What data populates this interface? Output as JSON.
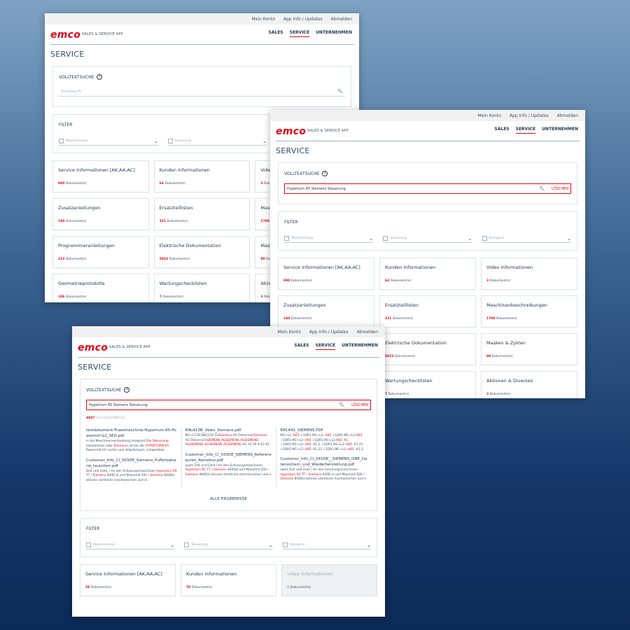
{
  "topbar": {
    "account": "Mein Konto",
    "appinfo": "App Info / Updates",
    "logout": "Abmelden"
  },
  "brand": {
    "logo": "emco",
    "app_name": "SALES & SERVICE APP"
  },
  "nav": {
    "sales": "SALES",
    "service": "SERVICE",
    "company": "UNTERNEHMEN"
  },
  "page_title": "SERVICE",
  "search": {
    "title": "VOLLTEXTSUCHE",
    "info": "i",
    "placeholder": "Suchbegriff",
    "query": "Hyperturn 65 Siemens Steuerung",
    "clear": "LÖSCHEN",
    "search_icon": "search-icon"
  },
  "filter": {
    "title": "FILTER",
    "machine": "Maschinentyp",
    "control": "Steuerung",
    "category": "Kategorie"
  },
  "doc_suffix": "Dokument(e)",
  "tiles": [
    {
      "title": "Service Informationen [AK,AA,AC]",
      "count": "900"
    },
    {
      "title": "Kunden Informationen",
      "count": "64"
    },
    {
      "title": "Video Informationen",
      "count": "3"
    },
    {
      "title": "Zusatzanleitungen",
      "count": "160"
    },
    {
      "title": "Ersatzteillisten",
      "count": "321"
    },
    {
      "title": "Maschinenbeschreibungen",
      "count": "1708"
    },
    {
      "title": "Programmieranleitungen",
      "count": "213"
    },
    {
      "title": "Elektrische Dokumentation",
      "count": "5023"
    },
    {
      "title": "Masken & Zyklen",
      "count": "89"
    },
    {
      "title": "Geometrieprotokolle",
      "count": "106"
    },
    {
      "title": "Wartungschecklisten",
      "count": "7"
    },
    {
      "title": "Aktionen & Diverses",
      "count": "3"
    }
  ],
  "w1_tiles_visible": [
    "Service Informationen [AK,AA,AC]",
    "Kunden Informationen",
    "Video",
    "Zusatzanleitungen",
    "Ersatzteillisten",
    "Masch",
    "Programmieranleitungen",
    "Elektrische Dokumentation",
    "Mask",
    "Geometrieprotokolle",
    "Wartungschecklisten",
    "Aktion"
  ],
  "w2_row3_partial": [
    "Elektrische Dokumentation",
    "Wartungschecklisten"
  ],
  "results_window": {
    "hits_count": "4047",
    "hits_label": "SUCHERGEBNISSE",
    "all_results": "ALLE ERGEBNISSE",
    "results": [
      [
        {
          "title": "testdokument-Fraesmaschine-Hyperturn-65-Powermill-G2_SEO.pdf",
          "snippet": [
            [
              "in die Maschinenverkleidung integriert.Die ",
              ""
            ],
            [
              "Steuerung",
              "hl"
            ],
            [
              " (Heidenhain oder ",
              ""
            ],
            [
              "Siemens",
              "hl"
            ],
            [
              ") ist bei der ",
              ""
            ],
            [
              "HYPERTURN 65",
              "hl"
            ],
            [
              " Powermill G2 rechts vom Arbeitsraum, schwenkbar",
              ""
            ]
          ]
        },
        {
          "title": "Customer_Info_CI_003DE_Siemens_Pufferbatterie_tauschen.pdf",
          "snippet": [
            [
              "Zeit und Geld. / An den Schulungsmaschinen ",
              ""
            ],
            [
              "Hyperturn 65",
              "hl"
            ],
            [
              " TT / ",
              ""
            ],
            [
              "Siemens",
              "hl"
            ],
            [
              " 840D sl und Maxxmill 500 / ",
              ""
            ],
            [
              "Siemens",
              "hl"
            ],
            [
              " 840Dsl können sämtliche mechanischen und el",
              ""
            ]
          ]
        }
      ],
      [
        {
          "title": "R9LA13B_Valeo_Siemens.pdf",
          "snippet": [
            [
              "M2+L178.SW2155 51",
              ""
            ],
            [
              "Siemens",
              "hl"
            ],
            [
              " AG Österreich",
              ""
            ],
            [
              "Siemens",
              "hl"
            ],
            [
              " AG Österreich",
              ""
            ],
            [
              "SIEMENS AGSIEMENS AGSIEMENS AGSIEMENS AGSIEMENS AGSIEMENS",
              "hl"
            ],
            [
              " AG 10 76 8 93 42",
              ""
            ]
          ]
        },
        {
          "title": "Customer_Info_CI_030DE_SIEMENS_Referenzpunkt_Korrektur.pdf",
          "snippet": [
            [
              "spart Zeit und Geld / An den Schulungsmaschinen ",
              ""
            ],
            [
              "Hyperturn 65",
              "hl"
            ],
            [
              " TT / ",
              ""
            ],
            [
              "Siemens",
              "hl"
            ],
            [
              " 840Dsl und Maxxmill 500 / ",
              ""
            ],
            [
              "Siemens",
              "hl"
            ],
            [
              " 840Dsl können sämtliche mechanischen und e",
              ""
            ]
          ]
        }
      ],
      [
        {
          "title": "R9CA91_SIEMENS.PDF",
          "snippet": [
            [
              "M1+L2-",
              ""
            ],
            [
              "-A65",
              "hl"
            ],
            [
              " +1DR1.M1+L2-",
              ""
            ],
            [
              "-A65",
              "hl"
            ],
            [
              " +1DR1.M1+L2-",
              ""
            ],
            [
              "A65",
              "hl"
            ],
            [
              " +1DR1.M1+L2-",
              ""
            ],
            [
              "-A65",
              "hl"
            ],
            [
              " +1DR1.M1+L2-",
              ""
            ],
            [
              "A65",
              "hl"
            ],
            [
              " -X1 +1DR1.M1+L2-",
              ""
            ],
            [
              "-A65",
              "hl"
            ],
            [
              " -X1.1 +1DR1.M1+L2-",
              ""
            ],
            [
              "-A65",
              "hl"
            ],
            [
              " -X1.21 +1DR1.M1+L2-",
              ""
            ],
            [
              "-A65",
              "hl"
            ],
            [
              " -X1.22 +1DR1.M1+L2-",
              ""
            ],
            [
              "-A65",
              "hl"
            ],
            [
              " -X1.3",
              ""
            ]
          ]
        },
        {
          "title": "Customer_Info_CI_041DE__SIEMENS_ONE_Datensichern_und_Wiederherstellung.pdf",
          "snippet": [
            [
              "spart Zeit und Geld / An den Schulungsmaschinen ",
              ""
            ],
            [
              "Hyperturn 65",
              "hl"
            ],
            [
              " TT / ",
              ""
            ],
            [
              "Siemens",
              "hl"
            ],
            [
              " 840D sl und Maxxmill 500 / ",
              ""
            ],
            [
              "Siemens",
              "hl"
            ],
            [
              " 840Dsl können sämtliche mechanischen und e",
              ""
            ]
          ]
        }
      ]
    ],
    "tiles": [
      {
        "title": "Service Informationen [AK,AA,AC]",
        "count": "29",
        "disabled": false
      },
      {
        "title": "Kunden Informationen",
        "count": "50",
        "disabled": false
      },
      {
        "title": "Video Informationen",
        "count": "0",
        "disabled": true
      }
    ]
  },
  "colors": {
    "accent": "#e30613",
    "text": "#22384f"
  }
}
